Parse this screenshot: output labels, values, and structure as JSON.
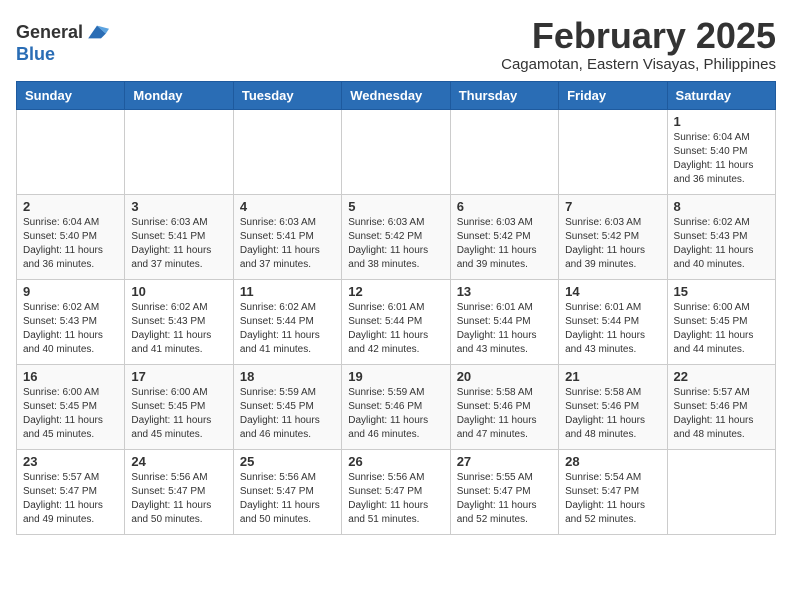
{
  "app": {
    "logo_general": "General",
    "logo_blue": "Blue"
  },
  "header": {
    "month_title": "February 2025",
    "subtitle": "Cagamotan, Eastern Visayas, Philippines"
  },
  "weekdays": [
    "Sunday",
    "Monday",
    "Tuesday",
    "Wednesday",
    "Thursday",
    "Friday",
    "Saturday"
  ],
  "weeks": [
    [
      {
        "day": "",
        "text": ""
      },
      {
        "day": "",
        "text": ""
      },
      {
        "day": "",
        "text": ""
      },
      {
        "day": "",
        "text": ""
      },
      {
        "day": "",
        "text": ""
      },
      {
        "day": "",
        "text": ""
      },
      {
        "day": "1",
        "text": "Sunrise: 6:04 AM\nSunset: 5:40 PM\nDaylight: 11 hours\nand 36 minutes."
      }
    ],
    [
      {
        "day": "2",
        "text": "Sunrise: 6:04 AM\nSunset: 5:40 PM\nDaylight: 11 hours\nand 36 minutes."
      },
      {
        "day": "3",
        "text": "Sunrise: 6:03 AM\nSunset: 5:41 PM\nDaylight: 11 hours\nand 37 minutes."
      },
      {
        "day": "4",
        "text": "Sunrise: 6:03 AM\nSunset: 5:41 PM\nDaylight: 11 hours\nand 37 minutes."
      },
      {
        "day": "5",
        "text": "Sunrise: 6:03 AM\nSunset: 5:42 PM\nDaylight: 11 hours\nand 38 minutes."
      },
      {
        "day": "6",
        "text": "Sunrise: 6:03 AM\nSunset: 5:42 PM\nDaylight: 11 hours\nand 39 minutes."
      },
      {
        "day": "7",
        "text": "Sunrise: 6:03 AM\nSunset: 5:42 PM\nDaylight: 11 hours\nand 39 minutes."
      },
      {
        "day": "8",
        "text": "Sunrise: 6:02 AM\nSunset: 5:43 PM\nDaylight: 11 hours\nand 40 minutes."
      }
    ],
    [
      {
        "day": "9",
        "text": "Sunrise: 6:02 AM\nSunset: 5:43 PM\nDaylight: 11 hours\nand 40 minutes."
      },
      {
        "day": "10",
        "text": "Sunrise: 6:02 AM\nSunset: 5:43 PM\nDaylight: 11 hours\nand 41 minutes."
      },
      {
        "day": "11",
        "text": "Sunrise: 6:02 AM\nSunset: 5:44 PM\nDaylight: 11 hours\nand 41 minutes."
      },
      {
        "day": "12",
        "text": "Sunrise: 6:01 AM\nSunset: 5:44 PM\nDaylight: 11 hours\nand 42 minutes."
      },
      {
        "day": "13",
        "text": "Sunrise: 6:01 AM\nSunset: 5:44 PM\nDaylight: 11 hours\nand 43 minutes."
      },
      {
        "day": "14",
        "text": "Sunrise: 6:01 AM\nSunset: 5:44 PM\nDaylight: 11 hours\nand 43 minutes."
      },
      {
        "day": "15",
        "text": "Sunrise: 6:00 AM\nSunset: 5:45 PM\nDaylight: 11 hours\nand 44 minutes."
      }
    ],
    [
      {
        "day": "16",
        "text": "Sunrise: 6:00 AM\nSunset: 5:45 PM\nDaylight: 11 hours\nand 45 minutes."
      },
      {
        "day": "17",
        "text": "Sunrise: 6:00 AM\nSunset: 5:45 PM\nDaylight: 11 hours\nand 45 minutes."
      },
      {
        "day": "18",
        "text": "Sunrise: 5:59 AM\nSunset: 5:45 PM\nDaylight: 11 hours\nand 46 minutes."
      },
      {
        "day": "19",
        "text": "Sunrise: 5:59 AM\nSunset: 5:46 PM\nDaylight: 11 hours\nand 46 minutes."
      },
      {
        "day": "20",
        "text": "Sunrise: 5:58 AM\nSunset: 5:46 PM\nDaylight: 11 hours\nand 47 minutes."
      },
      {
        "day": "21",
        "text": "Sunrise: 5:58 AM\nSunset: 5:46 PM\nDaylight: 11 hours\nand 48 minutes."
      },
      {
        "day": "22",
        "text": "Sunrise: 5:57 AM\nSunset: 5:46 PM\nDaylight: 11 hours\nand 48 minutes."
      }
    ],
    [
      {
        "day": "23",
        "text": "Sunrise: 5:57 AM\nSunset: 5:47 PM\nDaylight: 11 hours\nand 49 minutes."
      },
      {
        "day": "24",
        "text": "Sunrise: 5:56 AM\nSunset: 5:47 PM\nDaylight: 11 hours\nand 50 minutes."
      },
      {
        "day": "25",
        "text": "Sunrise: 5:56 AM\nSunset: 5:47 PM\nDaylight: 11 hours\nand 50 minutes."
      },
      {
        "day": "26",
        "text": "Sunrise: 5:56 AM\nSunset: 5:47 PM\nDaylight: 11 hours\nand 51 minutes."
      },
      {
        "day": "27",
        "text": "Sunrise: 5:55 AM\nSunset: 5:47 PM\nDaylight: 11 hours\nand 52 minutes."
      },
      {
        "day": "28",
        "text": "Sunrise: 5:54 AM\nSunset: 5:47 PM\nDaylight: 11 hours\nand 52 minutes."
      },
      {
        "day": "",
        "text": ""
      }
    ]
  ]
}
